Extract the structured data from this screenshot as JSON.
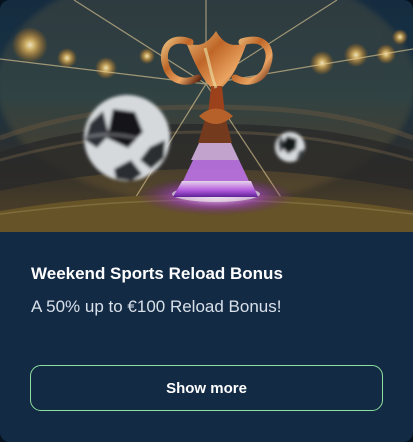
{
  "promo": {
    "image_description_icon": "trophy-stadium-image",
    "title": "Weekend Sports Reload Bonus",
    "subtitle": "A 50% up to €100 Reload Bonus!",
    "button_label": "Show more"
  },
  "colors": {
    "card_background": "#132a44",
    "button_border": "#8ddf9f",
    "title_text": "#ffffff",
    "subtitle_text": "#d8e0ea"
  }
}
